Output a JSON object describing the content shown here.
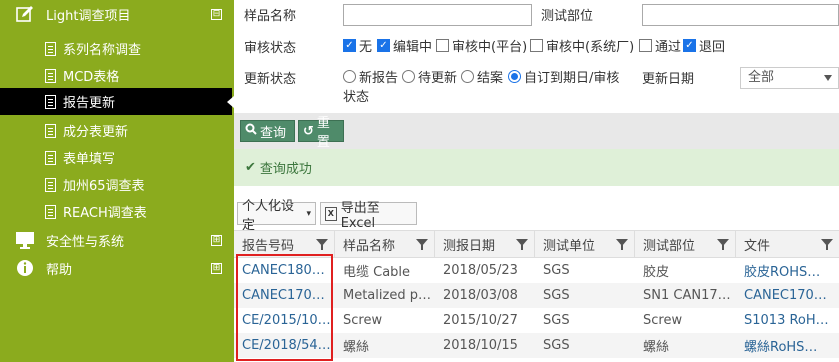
{
  "sidebar": {
    "group_main": {
      "label": "Light调查项目",
      "toggle": "⊟"
    },
    "items": [
      {
        "label": "系列名称调查"
      },
      {
        "label": "MCD表格"
      },
      {
        "label": "报告更新"
      },
      {
        "label": "成分表更新"
      },
      {
        "label": "表单填写"
      },
      {
        "label": "加州65调查表"
      },
      {
        "label": "REACH调查表"
      }
    ],
    "group_security": {
      "label": "安全性与系统",
      "toggle": "⊞"
    },
    "group_help": {
      "label": "帮助",
      "toggle": "⊞"
    }
  },
  "form": {
    "sample_name_label": "样品名称",
    "sample_name_value": "",
    "test_dept_label": "测试部位",
    "test_dept_value": "",
    "audit_status_label": "审核状态",
    "audit_options": [
      {
        "label": "无",
        "checked": true
      },
      {
        "label": "编辑中",
        "checked": true
      },
      {
        "label": "审核中(平台)",
        "checked": false
      },
      {
        "label": "审核中(系统厂)",
        "checked": false
      },
      {
        "label": "通过",
        "checked": false
      },
      {
        "label": "退回",
        "checked": true
      }
    ],
    "update_status_label": "更新状态",
    "update_options": [
      {
        "label": "新报告",
        "selected": false
      },
      {
        "label": "待更新",
        "selected": false
      },
      {
        "label": "结案",
        "selected": false
      },
      {
        "label": "自订到期日/审核",
        "selected": true
      }
    ],
    "update_status_suffix": "状态",
    "update_date_label": "更新日期",
    "update_date_value": "全部"
  },
  "toolbar": {
    "query_label": "查询",
    "reset_label": "重置"
  },
  "message": {
    "text": "查询成功"
  },
  "grid_toolbar": {
    "personalize_label": "个人化设定",
    "export_label": "导出至Excel"
  },
  "table": {
    "columns": [
      "报告号码",
      "样品名称",
      "测报日期",
      "测试单位",
      "测试部位",
      "文件"
    ],
    "rows": [
      [
        "CANEC180…",
        "电缆 Cable",
        "2018/05/23",
        "SGS",
        "胶皮",
        "胶皮ROHS…"
      ],
      [
        "CANEC170…",
        "Metalized p…",
        "2018/03/08",
        "SGS",
        "SN1 CAN17…",
        "CANEC170…"
      ],
      [
        "CE/2015/10…",
        "Screw",
        "2015/10/27",
        "SGS",
        "Screw",
        "S1013 RoH…"
      ],
      [
        "CE/2018/54…",
        "螺絲",
        "2018/10/15",
        "SGS",
        "螺絲",
        "螺絲RoHS…"
      ]
    ]
  },
  "colors": {
    "sidebar_bg": "#8bab1e",
    "active_item_bg": "#000000",
    "button_bg": "#4f8b6a",
    "success_bg": "#dff0d8",
    "highlight_border": "#e02020"
  }
}
